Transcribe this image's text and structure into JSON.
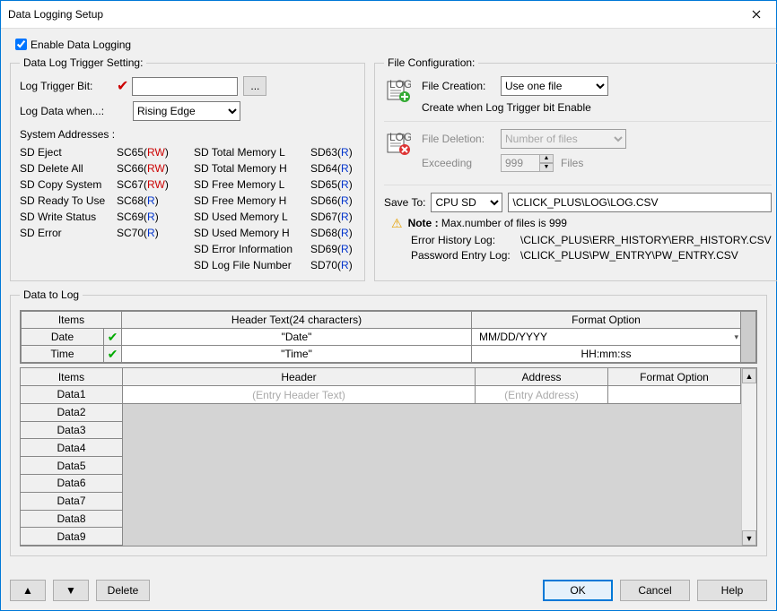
{
  "window": {
    "title": "Data Logging Setup"
  },
  "enable": {
    "label": "Enable Data Logging",
    "checked": true
  },
  "trigger": {
    "legend": "Data Log Trigger Setting:",
    "bit_label": "Log Trigger Bit:",
    "bit_value": "",
    "browse_label": "...",
    "when_label": "Log Data when...:",
    "when_value": "Rising Edge",
    "sys_addr_label": "System Addresses :",
    "left": [
      {
        "name": "SD Eject",
        "code": "SC65",
        "mode": "RW"
      },
      {
        "name": "SD Delete All",
        "code": "SC66",
        "mode": "RW"
      },
      {
        "name": "SD Copy System",
        "code": "SC67",
        "mode": "RW"
      },
      {
        "name": "SD Ready To Use",
        "code": "SC68",
        "mode": "R"
      },
      {
        "name": "SD Write Status",
        "code": "SC69",
        "mode": "R"
      },
      {
        "name": "SD Error",
        "code": "SC70",
        "mode": "R"
      }
    ],
    "right": [
      {
        "name": "SD Total Memory L",
        "code": "SD63",
        "mode": "R"
      },
      {
        "name": "SD Total Memory H",
        "code": "SD64",
        "mode": "R"
      },
      {
        "name": "SD Free Memory L",
        "code": "SD65",
        "mode": "R"
      },
      {
        "name": "SD Free Memory H",
        "code": "SD66",
        "mode": "R"
      },
      {
        "name": "SD Used Memory L",
        "code": "SD67",
        "mode": "R"
      },
      {
        "name": "SD Used Memory H",
        "code": "SD68",
        "mode": "R"
      },
      {
        "name": "SD Error Information",
        "code": "SD69",
        "mode": "R"
      },
      {
        "name": "SD Log File Number",
        "code": "SD70",
        "mode": "R"
      }
    ]
  },
  "fileconf": {
    "legend": "File Configuration:",
    "creation_label": "File Creation:",
    "creation_value": "Use one file",
    "creation_note": "Create when Log Trigger bit Enable",
    "deletion_label": "File Deletion:",
    "deletion_value": "Number of files",
    "exceeding_label": "Exceeding",
    "exceeding_value": "999",
    "files_label": "Files",
    "saveto_label": "Save To:",
    "saveto_device": "CPU SD",
    "saveto_path": "\\CLICK_PLUS\\LOG\\LOG.CSV",
    "note_prefix": "Note : ",
    "note_text": "Max.number of files is 999",
    "err_log_label": "Error History Log:",
    "err_log_path": "\\CLICK_PLUS\\ERR_HISTORY\\ERR_HISTORY.CSV",
    "pw_log_label": "Password Entry Log:",
    "pw_log_path": "\\CLICK_PLUS\\PW_ENTRY\\PW_ENTRY.CSV"
  },
  "datatolog": {
    "legend": "Data to Log",
    "h_items": "Items",
    "h_header_text": "Header Text(24 characters)",
    "h_format_option": "Format Option",
    "date_label": "Date",
    "date_header": "\"Date\"",
    "date_format": "MM/DD/YYYY",
    "time_label": "Time",
    "time_header": "\"Time\"",
    "time_format": "HH:mm:ss",
    "h2_items": "Items",
    "h2_header": "Header",
    "h2_address": "Address",
    "h2_format": "Format Option",
    "rows": [
      "Data1",
      "Data2",
      "Data3",
      "Data4",
      "Data5",
      "Data6",
      "Data7",
      "Data8",
      "Data9"
    ],
    "ph_header": "(Entry Header Text)",
    "ph_address": "(Entry Address)"
  },
  "footer": {
    "delete": "Delete",
    "ok": "OK",
    "cancel": "Cancel",
    "help": "Help"
  }
}
